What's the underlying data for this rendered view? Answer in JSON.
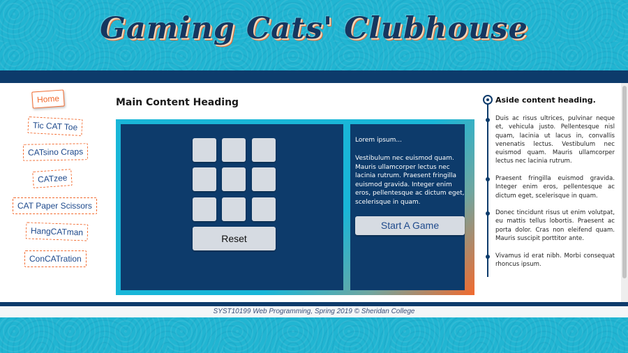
{
  "header": {
    "title": "Gaming Cats' Clubhouse"
  },
  "nav": {
    "items": [
      {
        "label": "Home"
      },
      {
        "label": "Tic CAT Toe"
      },
      {
        "label": "CATsino Craps"
      },
      {
        "label": "CATzee"
      },
      {
        "label": "CAT Paper Scissors"
      },
      {
        "label": "HangCATman"
      },
      {
        "label": "ConCATration"
      }
    ]
  },
  "main": {
    "heading": "Main Content Heading",
    "reset_label": "Reset",
    "info_title": "Lorem ipsum...",
    "info_body": "Vestibulum nec euismod quam. Mauris ullamcorper lectus nec lacinia rutrum. Praesent fringilla euismod gravida. Integer enim eros, pellentesque ac dictum eget, scelerisque in quam.",
    "start_label": "Start A Game"
  },
  "aside": {
    "heading": "Aside content heading.",
    "paragraphs": [
      "Duis ac risus ultrices, pulvinar neque et, vehicula justo. Pellentesque nisl quam, lacinia ut lacus in, convallis venenatis lectus. Vestibulum nec euismod quam. Mauris ullamcorper lectus nec lacinia rutrum.",
      "Praesent fringilla euismod gravida. Integer enim eros, pellentesque ac dictum eget, scelerisque in quam.",
      "Donec tincidunt risus ut enim volutpat, eu mattis tellus lobortis. Praesent ac porta dolor. Cras non eleifend quam. Mauris suscipit porttitor ante.",
      "Vivamus id erat nibh. Morbi consequat rhoncus ipsum."
    ]
  },
  "footer": {
    "text": "SYST10199 Web Programming, Spring 2019 © Sheridan College"
  },
  "colors": {
    "navy": "#0d3b6b",
    "cyan": "#1fb3cf",
    "orange": "#f26a2e",
    "tile": "#d6dbe2"
  }
}
